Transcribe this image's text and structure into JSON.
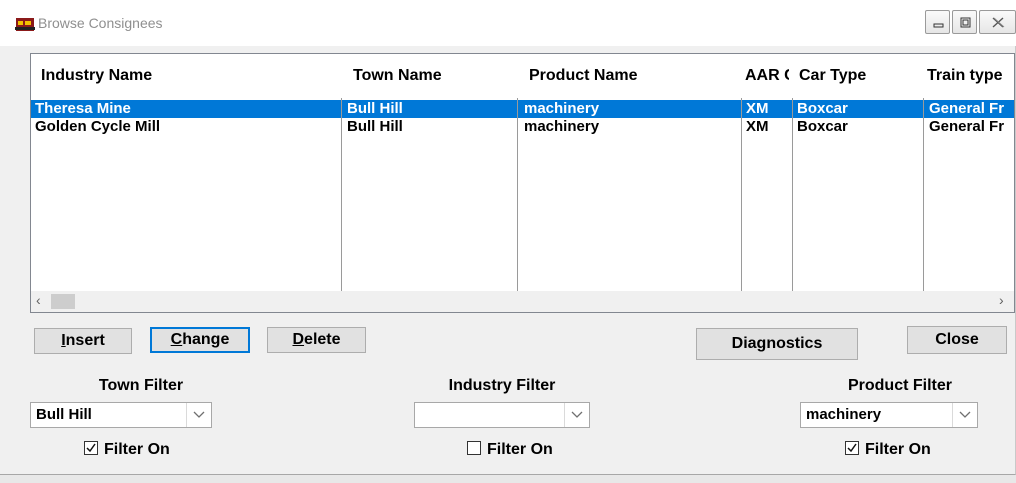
{
  "window": {
    "title": "Browse Consignees"
  },
  "columns": [
    "Industry Name",
    "Town Name",
    "Product Name",
    "AAR C",
    "Car Type",
    "Train type"
  ],
  "rows": [
    {
      "cells": [
        "Theresa Mine",
        "Bull Hill",
        "machinery",
        "XM",
        "Boxcar",
        "General Fr"
      ],
      "selected": true
    },
    {
      "cells": [
        "Golden Cycle Mill",
        "Bull Hill",
        "machinery",
        "XM",
        "Boxcar",
        "General Fr"
      ],
      "selected": false
    }
  ],
  "buttons": {
    "insert": {
      "accel": "I",
      "rest": "nsert"
    },
    "change": {
      "accel": "C",
      "rest": "hange"
    },
    "delete": {
      "accel": "D",
      "rest": "elete"
    },
    "diagnostics": "Diagnostics",
    "close": "Close"
  },
  "filters": {
    "town": {
      "label": "Town Filter",
      "value": "Bull Hill",
      "checkbox_label": "Filter On",
      "checked": true
    },
    "industry": {
      "label": "Industry Filter",
      "value": "",
      "checkbox_label": "Filter On",
      "checked": false
    },
    "product": {
      "label": "Product Filter",
      "value": "machinery",
      "checkbox_label": "Filter On",
      "checked": true
    }
  },
  "colors": {
    "selection": "#0078d7",
    "focus": "#0078d7"
  },
  "icons": [
    "app-icon",
    "minimize-icon",
    "maximize-icon",
    "close-icon",
    "scroll-left-icon",
    "scroll-right-icon",
    "chevron-down-icon",
    "checkbox-icon"
  ]
}
